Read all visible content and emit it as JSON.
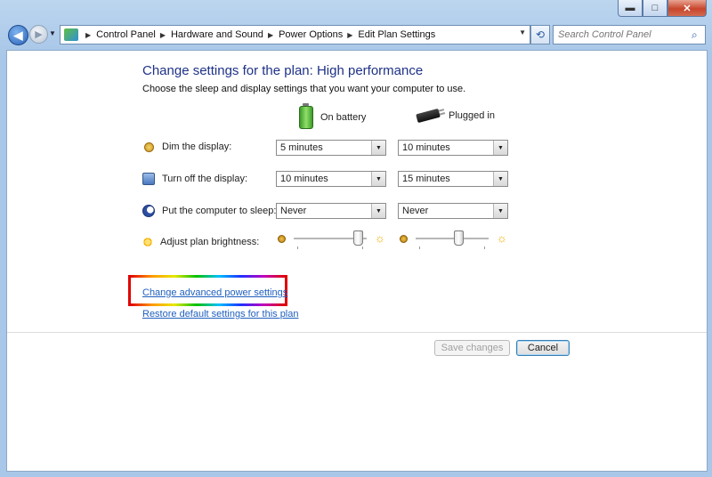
{
  "window": {
    "caption_buttons": {
      "minimize": "▬",
      "maximize": "□",
      "close": "✕"
    }
  },
  "nav": {
    "back_glyph": "◀",
    "forward_glyph": "▶",
    "recent_glyph": "▼",
    "breadcrumbs": [
      "Control Panel",
      "Hardware and Sound",
      "Power Options",
      "Edit Plan Settings"
    ],
    "crumb_separator": "▶",
    "address_dropdown_glyph": "▼",
    "refresh_glyph": "⟲",
    "search_placeholder": "Search Control Panel",
    "search_glyph": "⌕"
  },
  "page": {
    "heading": "Change settings for the plan: High performance",
    "subheading": "Choose the sleep and display settings that you want your computer to use.",
    "columns": {
      "on_battery": "On battery",
      "plugged_in": "Plugged in"
    },
    "settings": [
      {
        "label": "Dim the display:",
        "icon": "dim-icon",
        "on_battery": "5 minutes",
        "plugged_in": "10 minutes"
      },
      {
        "label": "Turn off the display:",
        "icon": "monitor-icon",
        "on_battery": "10 minutes",
        "plugged_in": "15 minutes"
      },
      {
        "label": "Put the computer to sleep:",
        "icon": "sleep-moon-icon",
        "on_battery": "Never",
        "plugged_in": "Never"
      }
    ],
    "brightness": {
      "label": "Adjust plan brightness:",
      "on_battery_level": 0.95,
      "plugged_in_level": 0.6,
      "high_glyph": "☼"
    },
    "select_arrow": "▼",
    "links": {
      "advanced": "Change advanced power settings",
      "restore": "Restore default settings for this plan"
    },
    "buttons": {
      "save": "Save changes",
      "cancel": "Cancel"
    }
  },
  "colors": {
    "heading": "#1e3287",
    "link": "#1f5fbf",
    "chrome": "#a9c7e8"
  }
}
